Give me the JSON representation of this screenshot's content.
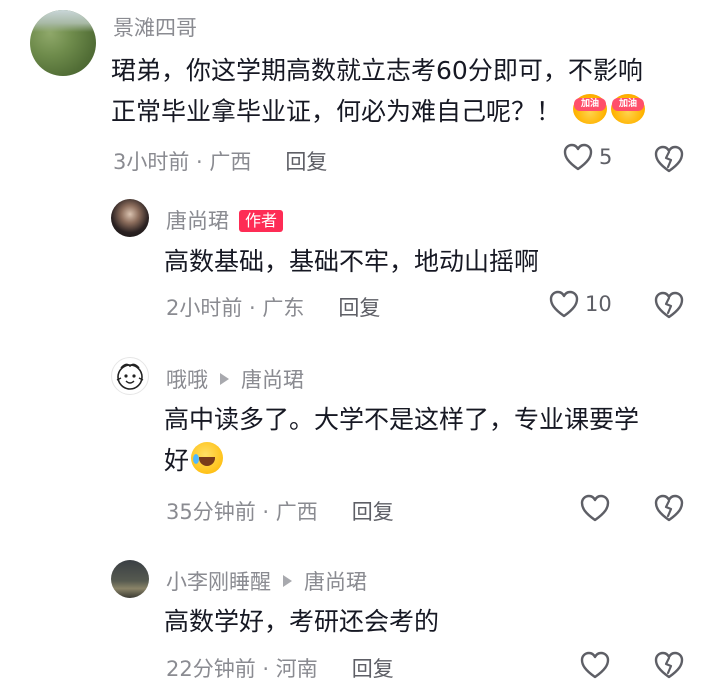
{
  "comments": [
    {
      "nickname": "景滩四哥",
      "text_line1": "珺弟，你这学期高数就立志考60分即可，不影响",
      "text_line2": "正常毕业拿毕业证，何必为难自己呢？！",
      "emoji_label": "加油",
      "time": "3小时前",
      "location": "广西",
      "reply_label": "回复",
      "likes": "5"
    },
    {
      "nickname": "唐尚珺",
      "badge": "作者",
      "text_line1": "高数基础，基础不牢，地动山摇啊",
      "time": "2小时前",
      "location": "广东",
      "reply_label": "回复",
      "likes": "10"
    },
    {
      "nickname": "哦哦",
      "reply_to": "唐尚珺",
      "text_line1": "高中读多了。大学不是这样了，专业课要学",
      "text_line2": "好",
      "time": "35分钟前",
      "location": "广西",
      "reply_label": "回复"
    },
    {
      "nickname": "小李刚睡醒",
      "reply_to": "唐尚珺",
      "text_line1": "高数学好，考研还会考的",
      "time": "22分钟前",
      "location": "河南",
      "reply_label": "回复"
    }
  ],
  "separator": " · ",
  "icons": {
    "like": "heart-outline-icon",
    "dislike": "broken-heart-icon",
    "reply_arrow": "triangle-right-icon"
  }
}
